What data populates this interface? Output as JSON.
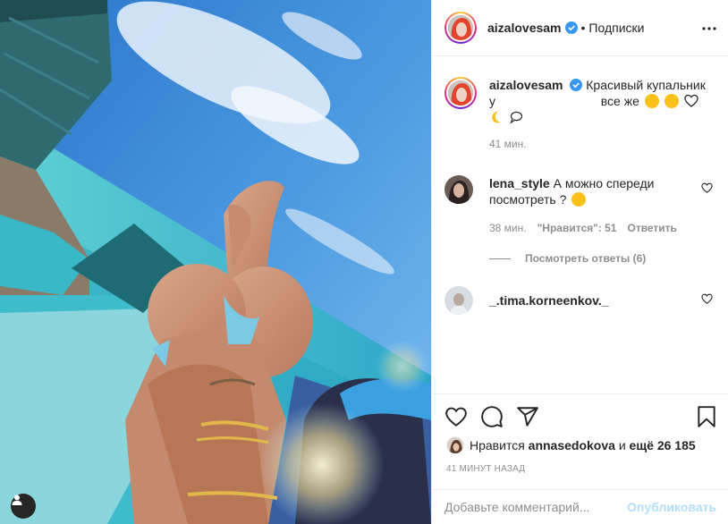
{
  "header": {
    "username": "aizalovesam",
    "dot": "•",
    "follow_label": "Подписки",
    "more_icon": "more-horizontal-icon"
  },
  "caption": {
    "username": "aizalovesam",
    "text_line1": "Красивый купальник",
    "text_line2_start": "у",
    "text_line2_end": "все же",
    "time": "41 мин."
  },
  "comments": [
    {
      "username": "lena_style",
      "text": "А можно спереди посмотреть ?",
      "time": "38 мин.",
      "likes": "\"Нравится\": 51",
      "reply_label": "Ответить",
      "view_replies": "Посмотреть ответы (6)"
    },
    {
      "username": "_.tima.korneenkov._"
    }
  ],
  "actions": {
    "liked_by_prefix": "Нравится",
    "liked_by_user": "annasedokova",
    "liked_by_suffix": "и",
    "liked_by_more": "ещё 26 185",
    "timestamp": "41 МИНУТ НАЗАД"
  },
  "add_comment": {
    "placeholder": "Добавьте комментарий...",
    "publish_label": "Опубликовать"
  },
  "colors": {
    "text": "#262626",
    "muted": "#8e8e8e",
    "verified": "#3897f0",
    "publish_disabled": "#b2dffc"
  }
}
